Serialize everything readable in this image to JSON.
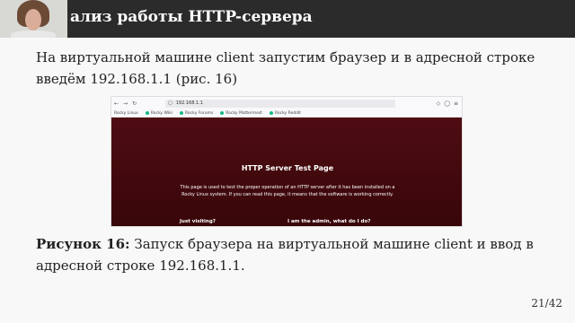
{
  "slide": {
    "title": "ализ работы HTTP-сервера",
    "body": "На виртуальной машине client запустим браузер и в адресной строке введём 192.168.1.1 (рис. 16)",
    "caption_label": "Рисунок 16:",
    "caption_text": " Запуск браузера на виртуальной машине client и ввод в адресной строке 192.168.1.1.",
    "page_number": "21/42"
  },
  "browser": {
    "url": "192.168.1.1",
    "bookmarks": [
      "Rocky Linux",
      "Rocky Wiki",
      "Rocky Forums",
      "Rocky Mattermost",
      "Rocky Reddit"
    ],
    "heading": "HTTP Server Test Page",
    "paragraph": "This page is used to test the proper operation of an HTTP server after it has been installed on a Rocky Linux system. If you can read this page, it means that the software is working correctly.",
    "link_visiting": "Just visiting?",
    "link_admin": "I am the admin, what do I do?"
  },
  "colors": {
    "titlebar": "#2b2b2b",
    "page_bg": "#4e0d12",
    "bookmark_icon": "#10b981"
  }
}
